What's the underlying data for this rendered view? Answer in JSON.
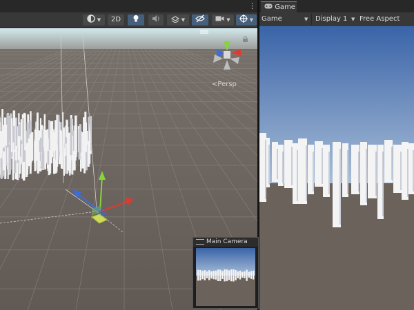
{
  "scene": {
    "menu_icon": "vertical-dots-icon",
    "toolbar": {
      "shading_icon": "shading-mode-icon",
      "mode_2d_label": "2D",
      "lighting_icon": "lightbulb-icon",
      "audio_icon": "audio-icon",
      "effects_icon": "effects-icon",
      "visibility_icon": "hidden-eye-icon",
      "camera_icon": "camera-icon",
      "gizmos_icon": "gizmos-icon"
    },
    "orientation_gizmo": {
      "y_label": "y",
      "projection_label": "Persp"
    }
  },
  "game": {
    "tab_label": "Game",
    "tab_icon": "gamepad-icon",
    "view_selector": "Game",
    "display_selector": "Display 1",
    "aspect_selector": "Free Aspect"
  },
  "camera_preview": {
    "title": "Main Camera"
  },
  "colors": {
    "editor_bg": "#282828",
    "toolbar_bg": "#383838",
    "active_button": "#46607c",
    "tab_highlight": "#4a8be0",
    "ground": "#6b625c",
    "sky_top": "#3a64a8",
    "sky_horizon": "#aabfd8",
    "gizmo_x": "#e03a2e",
    "gizmo_y": "#86d43c",
    "gizmo_z": "#3a6ee0"
  }
}
